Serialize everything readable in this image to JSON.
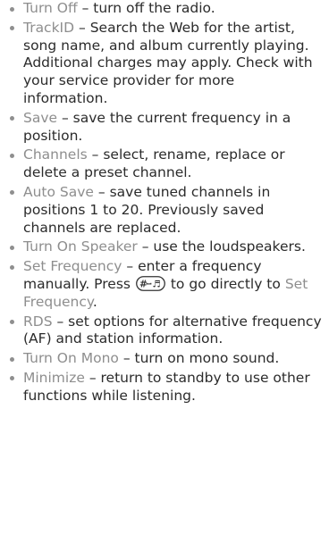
{
  "list": {
    "items": [
      {
        "term": "Turn Off",
        "sep": " – ",
        "desc": "turn off the radio."
      },
      {
        "term": "TrackID",
        "sep": " – ",
        "desc": "Search the Web for the artist, song name, and album currently playing. Additional charges may apply. Check with your service provider for more information."
      },
      {
        "term": "Save",
        "sep": " – ",
        "desc": "save the current frequency in a position."
      },
      {
        "term": "Channels",
        "sep": " – ",
        "desc": "select, rename, replace or delete a preset channel."
      },
      {
        "term": "Auto Save",
        "sep": " – ",
        "desc": "save tuned channels in positions 1 to 20. Previously saved channels are replaced."
      },
      {
        "term": "Turn On Speaker",
        "sep": " – ",
        "desc": "use the loudspeakers."
      },
      {
        "term": "Set Frequency",
        "sep": " – ",
        "desc_before": "enter a frequency manually. Press",
        "key_icon": "hash-key-icon",
        "desc_after": "to go directly to",
        "term_ref": "Set Frequency",
        "end": "."
      },
      {
        "term": "RDS",
        "sep": " – ",
        "desc": "set options for alternative frequency (AF) and station information."
      },
      {
        "term": "Turn On Mono",
        "sep": " – ",
        "desc": "turn on mono sound."
      },
      {
        "term": "Minimize",
        "sep": " – ",
        "desc": "return to standby to use other functions while listening."
      }
    ]
  },
  "colors": {
    "text": "#2b2b2b",
    "term": "#8e8e8e",
    "bullet": "#8f8f8f"
  }
}
